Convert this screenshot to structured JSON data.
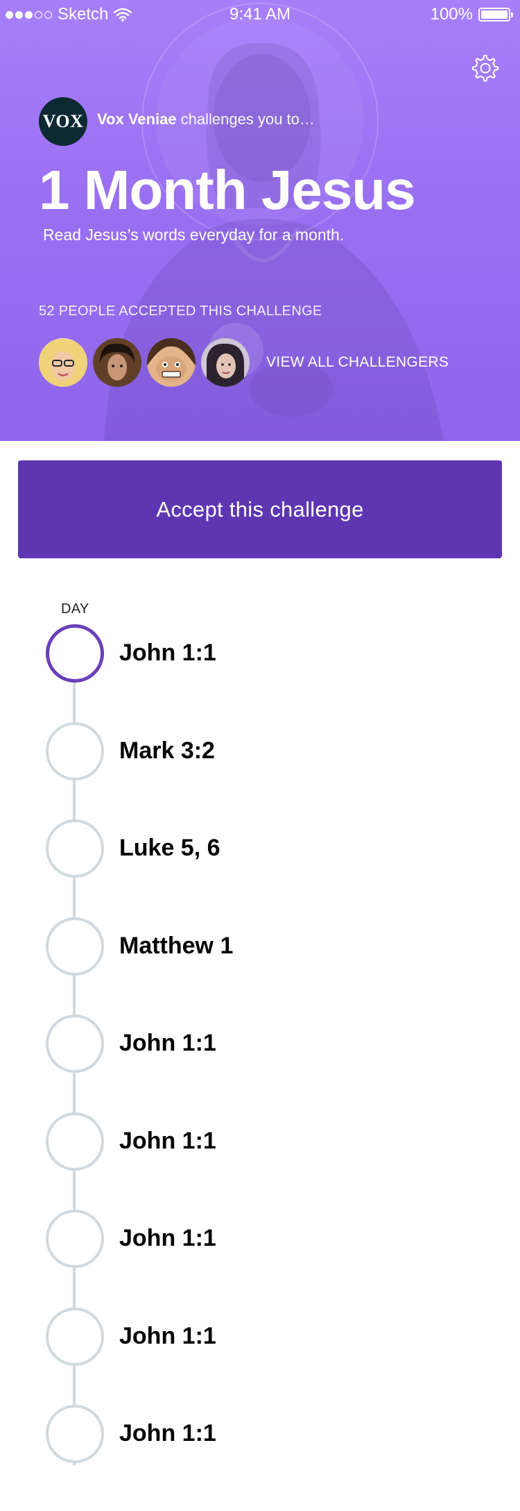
{
  "status_bar": {
    "carrier": "Sketch",
    "time": "9:41 AM",
    "battery_text": "100%",
    "battery_level": 1.0,
    "signal_bars_filled": 3,
    "signal_bars_total": 5,
    "icons": [
      "wifi-icon",
      "battery-icon"
    ]
  },
  "header": {
    "settings_icon": "gear-icon",
    "challenger_avatar_text": "VOX",
    "challenger_name": "Vox Veniae",
    "challenger_suffix": " challenges you to…",
    "title": "1 Month Jesus",
    "subtitle": "Read Jesus’s words everyday for a month.",
    "accepted_count": "52 PEOPLE ACCEPTED THIS CHALLENGE",
    "view_all": "VIEW ALL CHALLENGERS"
  },
  "accept_button": {
    "label": "Accept this challenge"
  },
  "timeline": {
    "header": "DAY",
    "days": [
      {
        "label": "John 1:1",
        "active": true
      },
      {
        "label": "Mark 3:2",
        "active": false
      },
      {
        "label": "Luke 5, 6",
        "active": false
      },
      {
        "label": "Matthew 1",
        "active": false
      },
      {
        "label": "John 1:1",
        "active": false
      },
      {
        "label": "John 1:1",
        "active": false
      },
      {
        "label": "John 1:1",
        "active": false
      },
      {
        "label": "John 1:1",
        "active": false
      },
      {
        "label": "John 1:1",
        "active": false
      }
    ]
  },
  "colors": {
    "hero_purple": "#9a70f2",
    "button_purple": "#5e36b1",
    "active_ring": "#6a3fb8",
    "inactive_ring": "#d1d9de"
  }
}
